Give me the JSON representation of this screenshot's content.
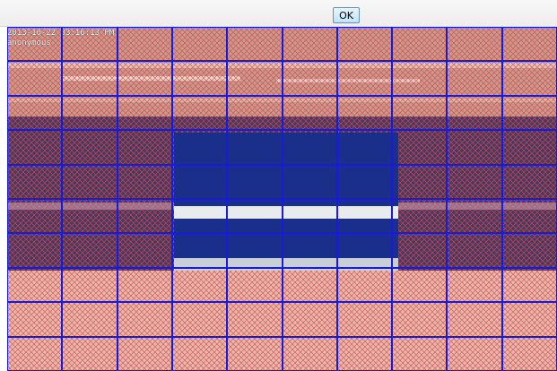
{
  "toolbar": {
    "ok_label": "OK"
  },
  "video": {
    "timestamp": "2013-10-22 03:16:13 PM",
    "channel_name": "anonymous",
    "grid": {
      "columns": 10,
      "rows": 10
    },
    "colors": {
      "grid_line": "#1a1adb",
      "unmasked_hatch": "#d64a4a",
      "masked_overlay": "#1a2f8a"
    }
  }
}
